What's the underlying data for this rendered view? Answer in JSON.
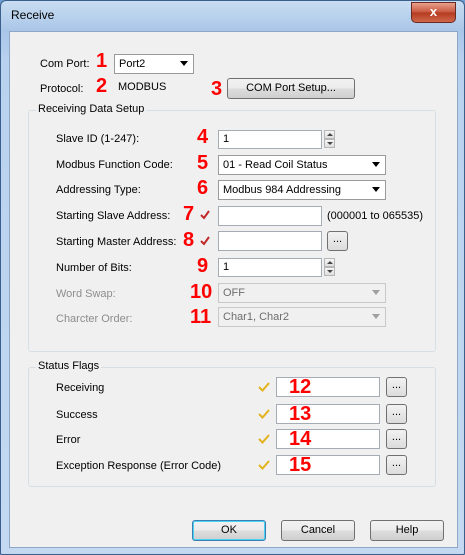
{
  "window": {
    "title": "Receive",
    "close_label": "x"
  },
  "connection": {
    "com_port_label": "Com Port:",
    "com_port_value": "Port2",
    "protocol_label": "Protocol:",
    "protocol_value": "MODBUS",
    "com_port_setup_label": "COM Port Setup..."
  },
  "receiving": {
    "group_title": "Receiving Data Setup",
    "slave_id_label": "Slave ID (1-247):",
    "slave_id_value": "1",
    "function_code_label": "Modbus Function Code:",
    "function_code_value": "01 - Read Coil Status",
    "addressing_type_label": "Addressing Type:",
    "addressing_type_value": "Modbus 984 Addressing",
    "starting_slave_label": "Starting Slave Address:",
    "starting_slave_value": "",
    "starting_slave_range": "(000001 to 065535)",
    "starting_master_label": "Starting Master Address:",
    "starting_master_value": "",
    "number_of_bits_label": "Number of Bits:",
    "number_of_bits_value": "1",
    "word_swap_label": "Word Swap:",
    "word_swap_value": "OFF",
    "char_order_label": "Charcter Order:",
    "char_order_value": "Char1, Char2"
  },
  "status_flags": {
    "group_title": "Status Flags",
    "items": [
      {
        "label": "Receiving",
        "value": ""
      },
      {
        "label": "Success",
        "value": ""
      },
      {
        "label": "Error",
        "value": ""
      },
      {
        "label": "Exception Response (Error Code)",
        "value": ""
      }
    ]
  },
  "browse_label": "...",
  "markers": [
    "1",
    "2",
    "3",
    "4",
    "5",
    "6",
    "7",
    "8",
    "9",
    "10",
    "11",
    "12",
    "13",
    "14",
    "15"
  ],
  "buttons": {
    "ok": "OK",
    "cancel": "Cancel",
    "help": "Help"
  },
  "colors": {
    "marker": "#ff0000",
    "check_required": "#c0282a",
    "check_optional": "#e3b21c"
  }
}
